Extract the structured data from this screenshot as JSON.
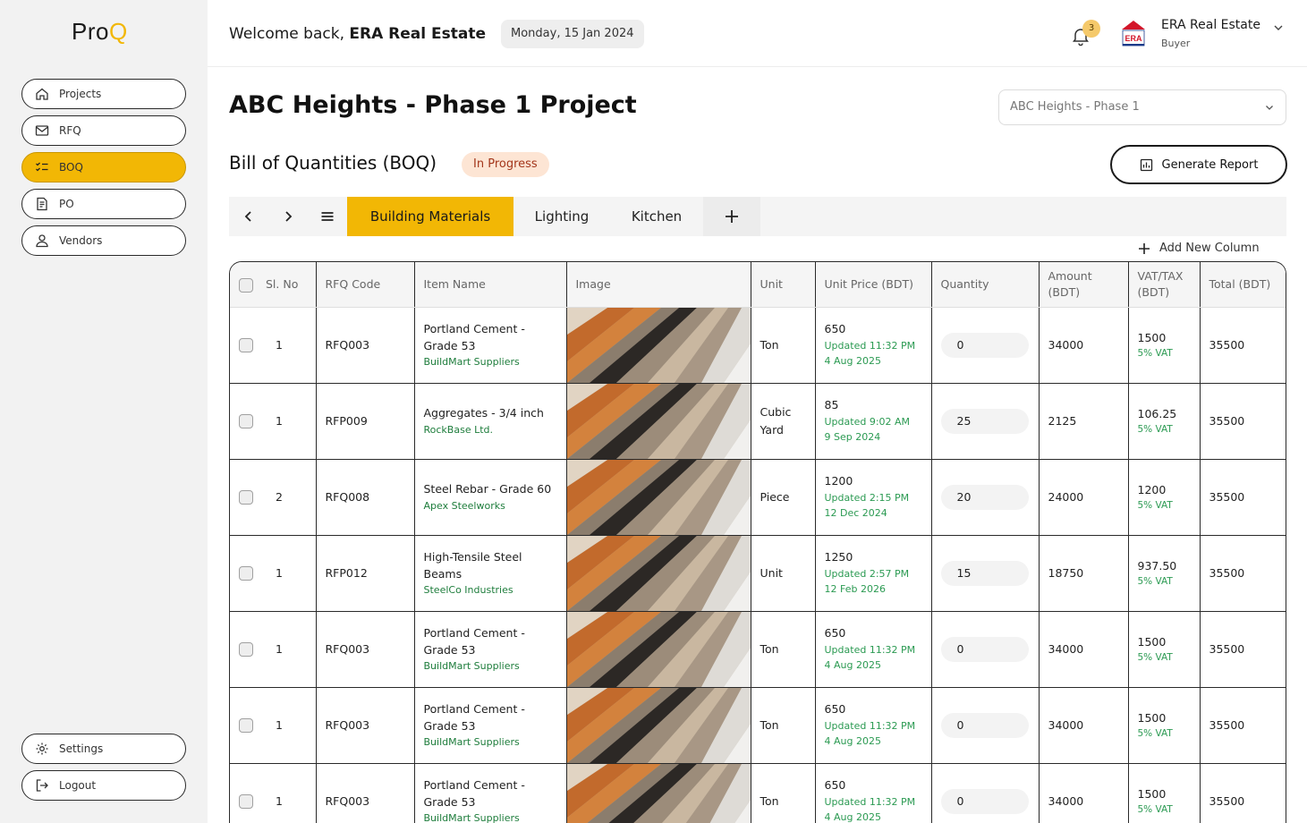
{
  "app": {
    "logo_a": "Pro",
    "logo_b": "Q"
  },
  "sidebar": {
    "items": [
      {
        "label": "Projects",
        "icon": "home-icon"
      },
      {
        "label": "RFQ",
        "icon": "mail-icon"
      },
      {
        "label": "BOQ",
        "icon": "checklist-icon",
        "active": true
      },
      {
        "label": "PO",
        "icon": "document-icon"
      },
      {
        "label": "Vendors",
        "icon": "user-icon"
      }
    ],
    "bottom": [
      {
        "label": "Settings",
        "icon": "gear-icon"
      },
      {
        "label": "Logout",
        "icon": "logout-icon"
      }
    ]
  },
  "header": {
    "welcome_prefix": "Welcome back,",
    "welcome_name": "ERA Real Estate",
    "date": "Monday, 15 Jan 2024",
    "notification_count": "3",
    "user_name": "ERA Real Estate",
    "user_role": "Buyer",
    "org_logo_text": "ERA"
  },
  "page": {
    "title": "ABC Heights - Phase 1 Project",
    "project_select": "ABC Heights - Phase 1",
    "section_title": "Bill of Quantities (BOQ)",
    "status": "In Progress",
    "report_button": "Generate Report"
  },
  "tabs": {
    "items": [
      "Building Materials",
      "Lighting",
      "Kitchen"
    ],
    "active": "Building Materials",
    "add_column": "Add New Column"
  },
  "table": {
    "columns": [
      "Sl. No",
      "RFQ Code",
      "Item Name",
      "Image",
      "Unit",
      "Unit Price (BDT)",
      "Quantity",
      "Amount (BDT)",
      "VAT/TAX (BDT)",
      "Total (BDT)"
    ],
    "rows": [
      {
        "sl": "1",
        "code": "RFQ003",
        "item": "Portland Cement - Grade 53",
        "supplier": "BuildMart Suppliers",
        "unit": "Ton",
        "price": "650",
        "updated": "Updated 11:32 PM",
        "updated_date": "4 Aug 2025",
        "qty": "0",
        "amount": "34000",
        "vat": "1500",
        "vat_note": "5% VAT",
        "total": "35500"
      },
      {
        "sl": "1",
        "code": "RFP009",
        "item": "Aggregates - 3/4 inch",
        "supplier": "RockBase Ltd.",
        "unit": "Cubic Yard",
        "price": "85",
        "updated": "Updated 9:02 AM",
        "updated_date": "9 Sep 2024",
        "qty": "25",
        "amount": "2125",
        "vat": "106.25",
        "vat_note": "5% VAT",
        "total": "35500"
      },
      {
        "sl": "2",
        "code": "RFQ008",
        "item": "Steel Rebar - Grade 60",
        "supplier": "Apex Steelworks",
        "unit": "Piece",
        "price": "1200",
        "updated": "Updated 2:15 PM",
        "updated_date": "12 Dec 2024",
        "qty": "20",
        "amount": "24000",
        "vat": "1200",
        "vat_note": "5% VAT",
        "total": "35500"
      },
      {
        "sl": "1",
        "code": "RFP012",
        "item": "High-Tensile Steel Beams",
        "supplier": "SteelCo Industries",
        "unit": "Unit",
        "price": "1250",
        "updated": "Updated 2:57 PM",
        "updated_date": "12 Feb 2026",
        "qty": "15",
        "amount": "18750",
        "vat": "937.50",
        "vat_note": "5% VAT",
        "total": "35500"
      },
      {
        "sl": "1",
        "code": "RFQ003",
        "item": "Portland Cement - Grade 53",
        "supplier": "BuildMart Suppliers",
        "unit": "Ton",
        "price": "650",
        "updated": "Updated 11:32 PM",
        "updated_date": "4 Aug 2025",
        "qty": "0",
        "amount": "34000",
        "vat": "1500",
        "vat_note": "5% VAT",
        "total": "35500"
      },
      {
        "sl": "1",
        "code": "RFQ003",
        "item": "Portland Cement - Grade 53",
        "supplier": "BuildMart Suppliers",
        "unit": "Ton",
        "price": "650",
        "updated": "Updated 11:32 PM",
        "updated_date": "4 Aug 2025",
        "qty": "0",
        "amount": "34000",
        "vat": "1500",
        "vat_note": "5% VAT",
        "total": "35500"
      },
      {
        "sl": "1",
        "code": "RFQ003",
        "item": "Portland Cement - Grade 53",
        "supplier": "BuildMart Suppliers",
        "unit": "Ton",
        "price": "650",
        "updated": "Updated 11:32 PM",
        "updated_date": "4 Aug 2025",
        "qty": "0",
        "amount": "34000",
        "vat": "1500",
        "vat_note": "5% VAT",
        "total": "35500"
      }
    ]
  },
  "colors": {
    "accent": "#f2b705",
    "status_bg": "#fde5d4",
    "status_text": "#a3361b",
    "supplier": "#1e7d3c"
  }
}
